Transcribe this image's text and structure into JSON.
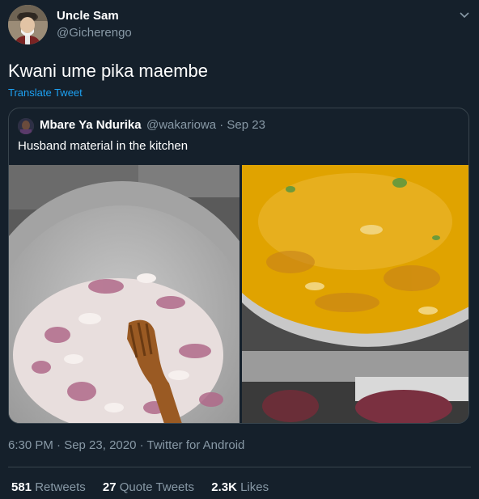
{
  "tweet": {
    "author_name": "Uncle Sam",
    "author_handle": "@Gicherengo",
    "text": "Kwani ume pika maembe",
    "translate_label": "Translate Tweet",
    "quoted": {
      "author_name": "Mbare Ya Ndurika",
      "meta": "@wakariowa · Sep 23",
      "text": "Husband material in the kitchen"
    },
    "timestamp": "6:30 PM · Sep 23, 2020 · Twitter for Android",
    "stats": {
      "retweets_count": "581",
      "retweets_label": "Retweets",
      "quotes_count": "27",
      "quotes_label": "Quote Tweets",
      "likes_count": "2.3K",
      "likes_label": "Likes"
    }
  },
  "icons": {
    "more": "chevron-down-icon"
  },
  "colors": {
    "background": "#15202b",
    "secondary_text": "#8899a6",
    "link": "#1da1f2",
    "border": "#38444d"
  }
}
